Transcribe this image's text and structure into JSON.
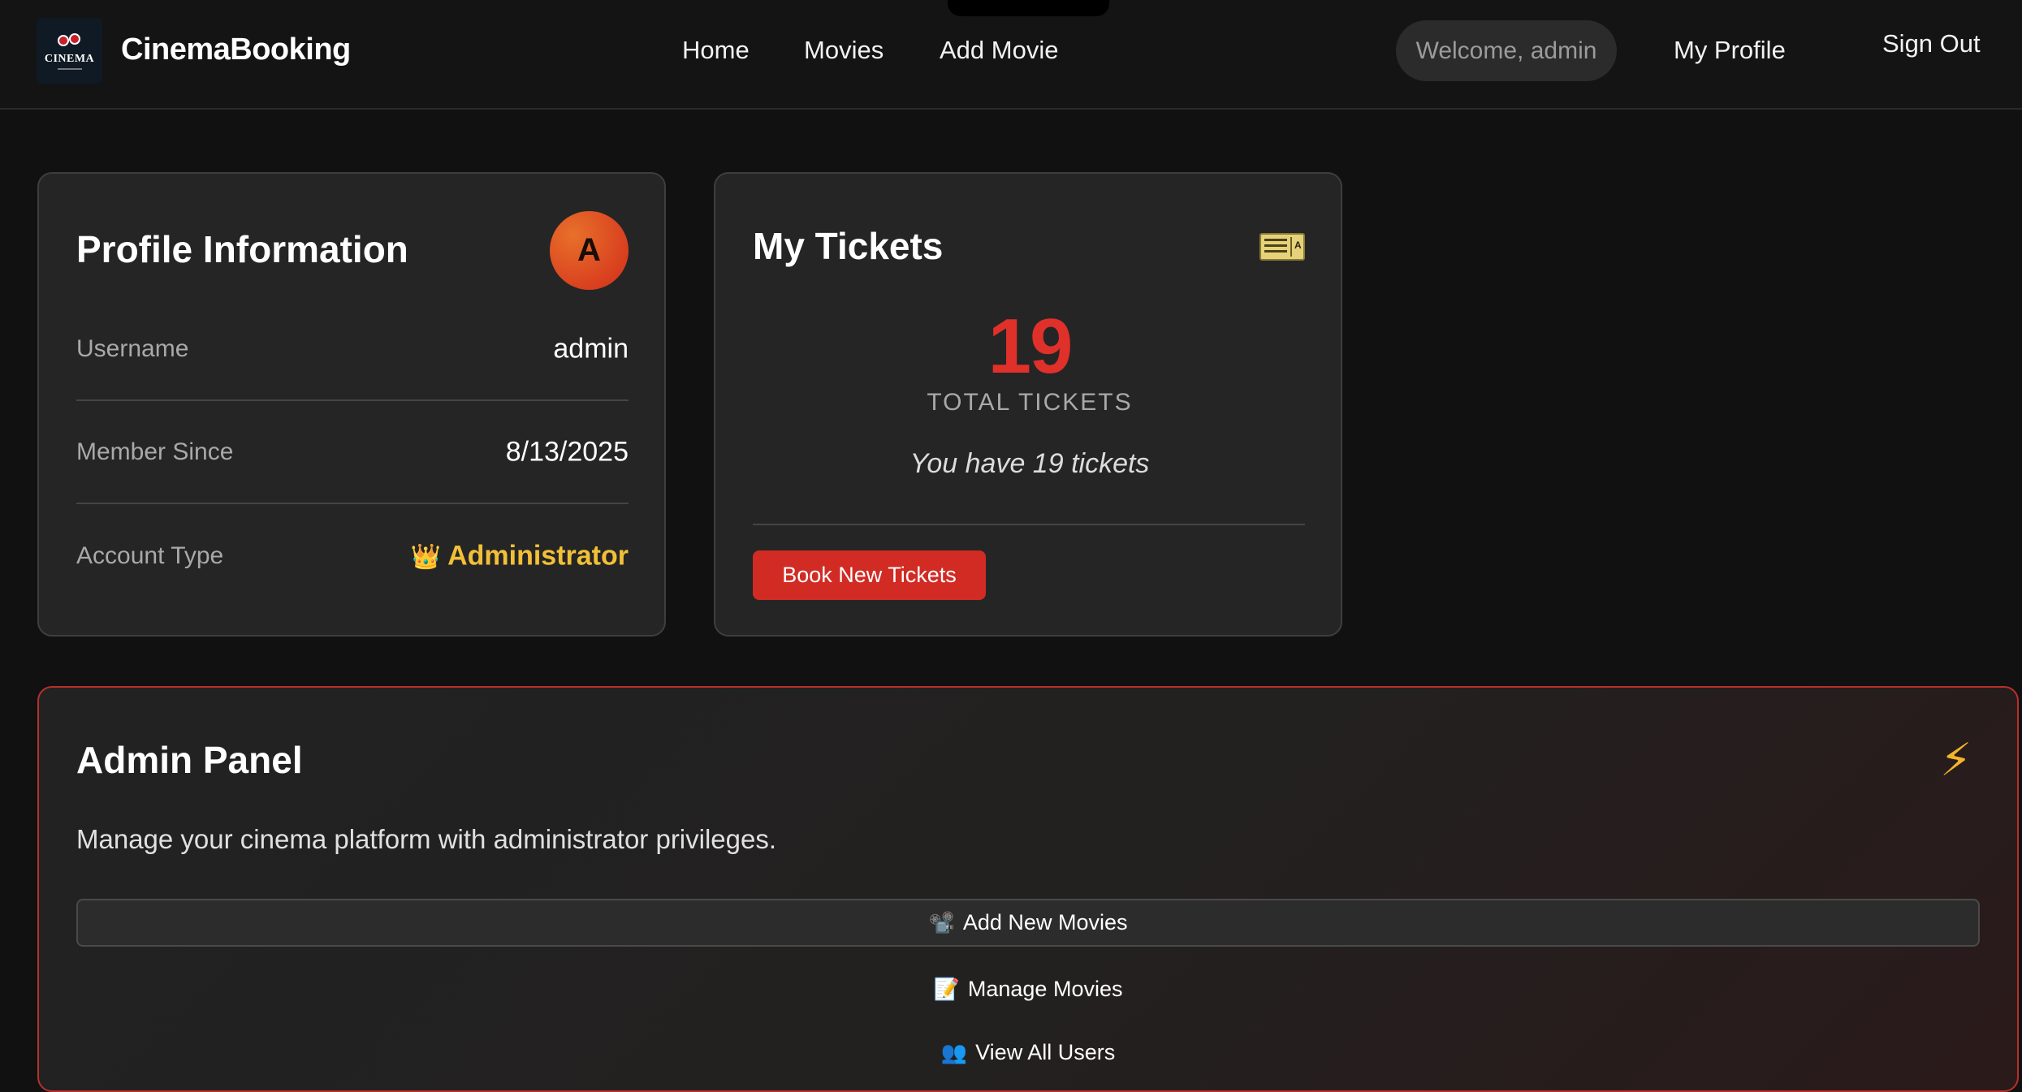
{
  "header": {
    "brand": "CinemaBooking",
    "logo_text": "CINEMA",
    "nav": [
      "Home",
      "Movies",
      "Add Movie"
    ],
    "welcome": "Welcome, admin",
    "my_profile": "My Profile",
    "sign_out": "Sign Out"
  },
  "profile": {
    "title": "Profile Information",
    "avatar_initial": "A",
    "rows": [
      {
        "label": "Username",
        "value": "admin"
      },
      {
        "label": "Member Since",
        "value": "8/13/2025"
      },
      {
        "label": "Account Type",
        "value": "Administrator",
        "icon": "👑"
      }
    ]
  },
  "tickets": {
    "title": "My Tickets",
    "count": "19",
    "count_label": "TOTAL TICKETS",
    "message": "You have 19 tickets",
    "book_button": "Book New Tickets",
    "ticket_icon_text": "A"
  },
  "admin": {
    "title": "Admin Panel",
    "description": "Manage your cinema platform with administrator privileges.",
    "bolt": "⚡",
    "actions": [
      {
        "icon": "📽️",
        "label": "Add New Movies"
      },
      {
        "icon": "📝",
        "label": "Manage Movies"
      },
      {
        "icon": "👥",
        "label": "View All Users"
      }
    ]
  },
  "colors": {
    "accent_red": "#d12b24",
    "admin_gold": "#f2c037",
    "card_bg": "#252525"
  }
}
